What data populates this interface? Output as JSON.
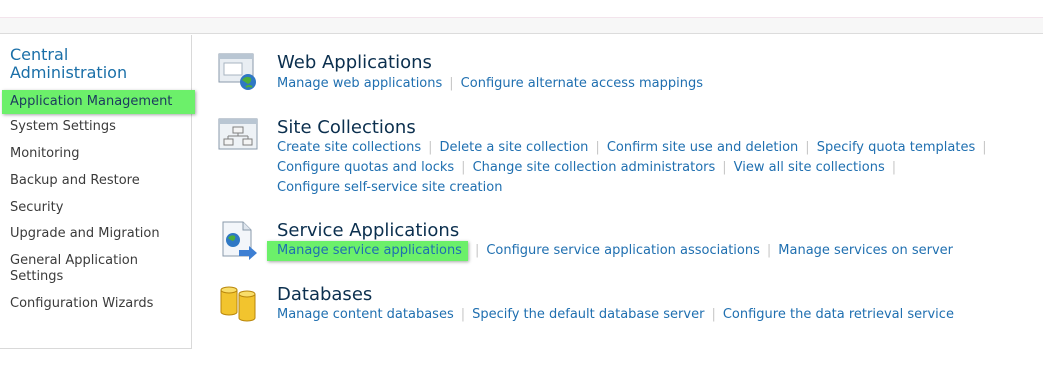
{
  "sidebar": {
    "title": "Central Administration",
    "items": [
      "Application Management",
      "System Settings",
      "Monitoring",
      "Backup and Restore",
      "Security",
      "Upgrade and Migration",
      "General Application Settings",
      "Configuration Wizards"
    ],
    "active_item": "Application Management"
  },
  "sections": {
    "web_applications": {
      "title": "Web Applications",
      "icon": "web-applications-icon",
      "links": [
        "Manage web applications",
        "Configure alternate access mappings"
      ]
    },
    "site_collections": {
      "title": "Site Collections",
      "icon": "site-collections-icon",
      "links": [
        "Create site collections",
        "Delete a site collection",
        "Confirm site use and deletion",
        "Specify quota templates",
        "Configure quotas and locks",
        "Change site collection administrators",
        "View all site collections",
        "Configure self-service site creation"
      ]
    },
    "service_applications": {
      "title": "Service Applications",
      "icon": "service-applications-icon",
      "links": [
        "Manage service applications",
        "Configure service application associations",
        "Manage services on server"
      ],
      "highlighted_link": "Manage service applications"
    },
    "databases": {
      "title": "Databases",
      "icon": "databases-icon",
      "links": [
        "Manage content databases",
        "Specify the default database server",
        "Configure the data retrieval service"
      ]
    }
  },
  "colors": {
    "link": "#1f6fb0",
    "heading": "#0b2f4e",
    "sidebar_title": "#1a6fa8",
    "highlight": "#6cf06a",
    "separator": "#c8c8c8"
  }
}
